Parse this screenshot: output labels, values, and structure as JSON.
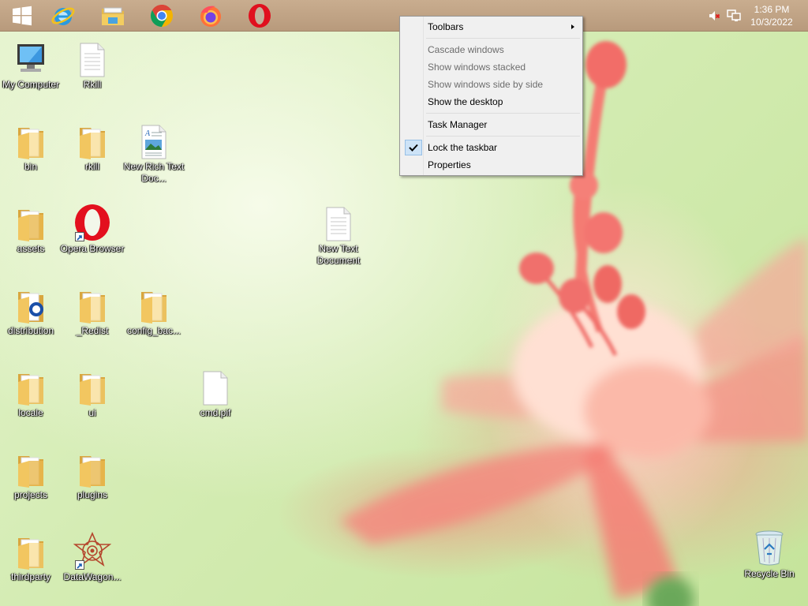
{
  "taskbar": {
    "pinned": [
      {
        "name": "start",
        "icon": "windows-logo-icon"
      },
      {
        "name": "internet-explorer",
        "icon": "internet-explorer-icon"
      },
      {
        "name": "file-explorer",
        "icon": "file-explorer-icon"
      },
      {
        "name": "chrome",
        "icon": "chrome-icon"
      },
      {
        "name": "firefox",
        "icon": "firefox-icon"
      },
      {
        "name": "opera",
        "icon": "opera-icon"
      }
    ],
    "tray": {
      "volume_icon": "volume-muted-icon",
      "network_icon": "network-icon",
      "time": "1:36 PM",
      "date": "10/3/2022"
    }
  },
  "desktop": {
    "icons": [
      {
        "label": "My Computer",
        "type": "computer"
      },
      {
        "label": "Rkill",
        "type": "file"
      },
      {
        "label": "bin",
        "type": "folder"
      },
      {
        "label": "rkill",
        "type": "folder"
      },
      {
        "label": "New Rich Text Doc...",
        "type": "rtf"
      },
      {
        "label": "assets",
        "type": "folder"
      },
      {
        "label": "Opera Browser",
        "type": "opera"
      },
      {
        "label": "New Text Document",
        "type": "file"
      },
      {
        "label": "distribution",
        "type": "folder"
      },
      {
        "label": "_Redist",
        "type": "folder"
      },
      {
        "label": "config_bac...",
        "type": "folder"
      },
      {
        "label": "locale",
        "type": "folder"
      },
      {
        "label": "ui",
        "type": "folder"
      },
      {
        "label": "cmd.pif",
        "type": "blank"
      },
      {
        "label": "projects",
        "type": "folder"
      },
      {
        "label": "plugins",
        "type": "folder"
      },
      {
        "label": "thirdparty",
        "type": "folder"
      },
      {
        "label": "DataWagon...",
        "type": "datawagon"
      },
      {
        "label": "Recycle Bin",
        "type": "recycle"
      }
    ]
  },
  "context_menu": {
    "items": [
      {
        "label": "Toolbars",
        "enabled": true,
        "submenu": true
      },
      {
        "label": "Cascade windows",
        "enabled": false
      },
      {
        "label": "Show windows stacked",
        "enabled": false
      },
      {
        "label": "Show windows side by side",
        "enabled": false
      },
      {
        "label": "Show the desktop",
        "enabled": true
      },
      {
        "label": "Task Manager",
        "enabled": true
      },
      {
        "label": "Lock the taskbar",
        "enabled": true,
        "checked": true
      },
      {
        "label": "Properties",
        "enabled": true
      }
    ]
  },
  "colors": {
    "taskbar": "#c0a385",
    "menu_bg": "#f0f0f0",
    "check_highlight": "#cde3f7"
  }
}
